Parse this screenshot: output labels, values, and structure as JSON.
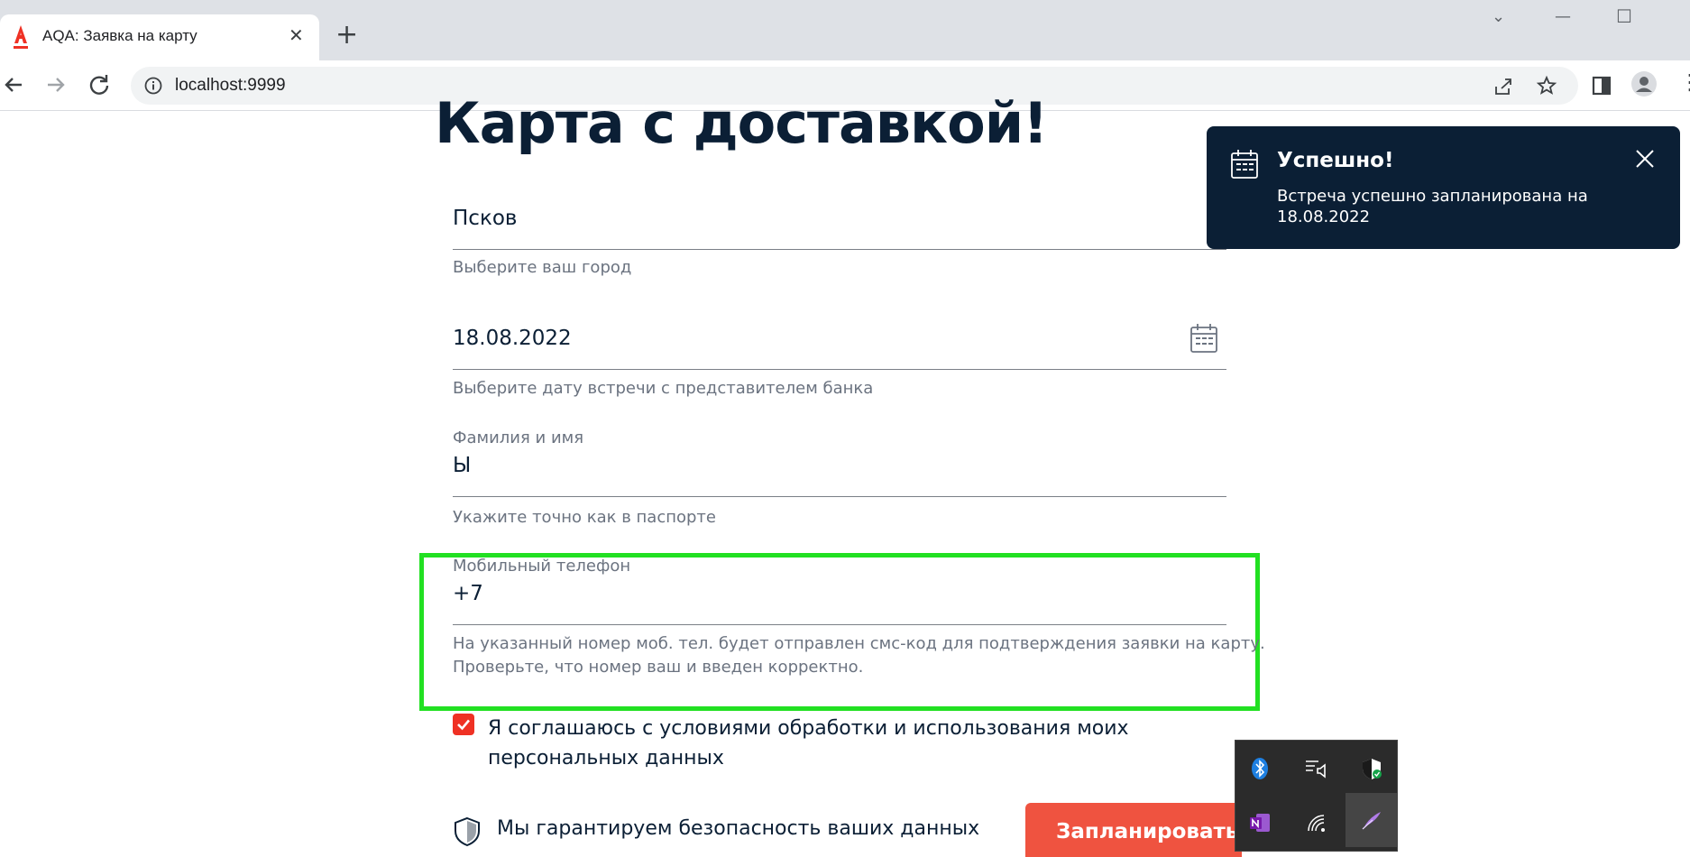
{
  "browser": {
    "tab_title": "AQA: Заявка на карту",
    "url": "localhost:9999"
  },
  "page": {
    "title": "Карта с доставкой!"
  },
  "form": {
    "city": {
      "value": "Псков",
      "hint": "Выберите ваш город"
    },
    "date": {
      "value": "18.08.2022",
      "hint": "Выберите дату встречи с представителем банка"
    },
    "name": {
      "label": "Фамилия и имя",
      "value": "Ы",
      "hint": "Укажите точно как в паспорте"
    },
    "phone": {
      "label": "Мобильный телефон",
      "value": "+7",
      "hint_line1": "На указанный номер моб. тел. будет отправлен смс-код для подтверждения заявки на карту.",
      "hint_line2": "Проверьте, что номер ваш и введен корректно."
    },
    "agreement": {
      "checked": true,
      "label_line1": "Я соглашаюсь с условиями обработки и использования моих",
      "label_line2": "персональных данных"
    },
    "security_text": "Мы гарантируем безопасность ваших данных",
    "submit_label": "Запланировать"
  },
  "notification": {
    "title": "Успешно!",
    "text_line1": "Встреча успешно запланирована на",
    "text_line2": "18.08.2022"
  },
  "colors": {
    "brand_red": "#ef3124",
    "dark_navy": "#0b1f35",
    "highlight_green": "#22e022"
  }
}
